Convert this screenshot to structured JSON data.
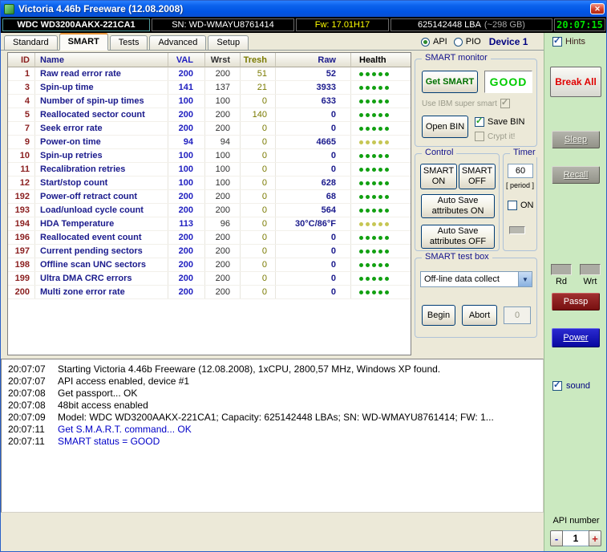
{
  "window": {
    "title": "Victoria 4.46b Freeware (12.08.2008)"
  },
  "info_bar": {
    "model": "WDC WD3200AAKX-221CA1",
    "serial": "SN: WD-WMAYU8761414",
    "firmware": "Fw: 17.01H17",
    "capacity": "625142448 LBA",
    "capacity_note": "(~298 GB)",
    "clock": "20:07:15"
  },
  "tabs": [
    "Standard",
    "SMART",
    "Tests",
    "Advanced",
    "Setup"
  ],
  "active_tab": "SMART",
  "mode_bar": {
    "api_label": "API",
    "pio_label": "PIO",
    "device_label": "Device 1",
    "hints_label": "Hints"
  },
  "smart_table": {
    "headers": [
      "ID",
      "Name",
      "VAL",
      "Wrst",
      "Tresh",
      "Raw",
      "Health"
    ],
    "health_dots": 5,
    "rows": [
      {
        "id": "1",
        "name": "Raw read error rate",
        "val": "200",
        "wrst": "200",
        "tresh": "51",
        "raw": "52",
        "health": "good"
      },
      {
        "id": "3",
        "name": "Spin-up time",
        "val": "141",
        "wrst": "137",
        "tresh": "21",
        "raw": "3933",
        "health": "good"
      },
      {
        "id": "4",
        "name": "Number of spin-up times",
        "val": "100",
        "wrst": "100",
        "tresh": "0",
        "raw": "633",
        "health": "good"
      },
      {
        "id": "5",
        "name": "Reallocated sector count",
        "val": "200",
        "wrst": "200",
        "tresh": "140",
        "raw": "0",
        "health": "good"
      },
      {
        "id": "7",
        "name": "Seek error rate",
        "val": "200",
        "wrst": "200",
        "tresh": "0",
        "raw": "0",
        "health": "good"
      },
      {
        "id": "9",
        "name": "Power-on time",
        "val": "94",
        "wrst": "94",
        "tresh": "0",
        "raw": "4665",
        "health": "warn"
      },
      {
        "id": "10",
        "name": "Spin-up retries",
        "val": "100",
        "wrst": "100",
        "tresh": "0",
        "raw": "0",
        "health": "good"
      },
      {
        "id": "11",
        "name": "Recalibration retries",
        "val": "100",
        "wrst": "100",
        "tresh": "0",
        "raw": "0",
        "health": "good"
      },
      {
        "id": "12",
        "name": "Start/stop count",
        "val": "100",
        "wrst": "100",
        "tresh": "0",
        "raw": "628",
        "health": "good"
      },
      {
        "id": "192",
        "name": "Power-off retract count",
        "val": "200",
        "wrst": "200",
        "tresh": "0",
        "raw": "68",
        "health": "good"
      },
      {
        "id": "193",
        "name": "Load/unload cycle count",
        "val": "200",
        "wrst": "200",
        "tresh": "0",
        "raw": "564",
        "health": "good"
      },
      {
        "id": "194",
        "name": "HDA Temperature",
        "val": "113",
        "wrst": "96",
        "tresh": "0",
        "raw": "30°C/86°F",
        "health": "warn"
      },
      {
        "id": "196",
        "name": "Reallocated event count",
        "val": "200",
        "wrst": "200",
        "tresh": "0",
        "raw": "0",
        "health": "good"
      },
      {
        "id": "197",
        "name": "Current pending sectors",
        "val": "200",
        "wrst": "200",
        "tresh": "0",
        "raw": "0",
        "health": "good"
      },
      {
        "id": "198",
        "name": "Offline scan UNC sectors",
        "val": "200",
        "wrst": "200",
        "tresh": "0",
        "raw": "0",
        "health": "good"
      },
      {
        "id": "199",
        "name": "Ultra DMA CRC errors",
        "val": "200",
        "wrst": "200",
        "tresh": "0",
        "raw": "0",
        "health": "good"
      },
      {
        "id": "200",
        "name": "Multi zone error rate",
        "val": "200",
        "wrst": "200",
        "tresh": "0",
        "raw": "0",
        "health": "good"
      }
    ]
  },
  "smart_monitor": {
    "title": "SMART monitor",
    "get_smart_button": "Get SMART",
    "status": "GOOD",
    "ibm_checkbox": "Use IBM super smart",
    "open_bin_button": "Open BIN",
    "save_bin_checkbox": "Save BIN",
    "crypt_checkbox": "Crypt it!"
  },
  "control": {
    "title": "Control",
    "smart_on_button": "SMART ON",
    "smart_off_button": "SMART OFF",
    "autosave_on_button": "Auto Save attributes ON",
    "autosave_off_button": "Auto Save attributes OFF"
  },
  "timer": {
    "title": "Timer",
    "value": "60",
    "period_label": "[ period ]",
    "on_label": "ON"
  },
  "test_box": {
    "title": "SMART test box",
    "selected_test": "Off-line data collect",
    "begin_button": "Begin",
    "abort_button": "Abort",
    "counter_value": "0"
  },
  "right_panel": {
    "break_all_button": "Break All",
    "sleep_button": "Sleep",
    "recall_button": "Recall",
    "rd_label": "Rd",
    "wrt_label": "Wrt",
    "passp_button": "Passp",
    "power_button": "Power",
    "sound_label": "sound",
    "api_number_label": "API number",
    "api_minus": "-",
    "api_value": "1",
    "api_plus": "+"
  },
  "log": {
    "lines": [
      {
        "time": "20:07:07",
        "text": "Starting Victoria 4.46b Freeware (12.08.2008), 1xCPU, 2800,57 MHz, Windows XP found.",
        "color": "black"
      },
      {
        "time": "20:07:07",
        "text": "API access enabled, device #1",
        "color": "black"
      },
      {
        "time": "20:07:08",
        "text": "Get passport... OK",
        "color": "black"
      },
      {
        "time": "20:07:08",
        "text": "48bit access enabled",
        "color": "black"
      },
      {
        "time": "20:07:09",
        "text": "Model: WDC WD3200AAKX-221CA1; Capacity: 625142448 LBAs; SN: WD-WMAYU8761414; FW: 1...",
        "color": "black"
      },
      {
        "time": "20:07:11",
        "text": "Get S.M.A.R.T. command... OK",
        "color": "blue"
      },
      {
        "time": "20:07:11",
        "text": "SMART status = GOOD",
        "color": "blue"
      }
    ]
  },
  "colors": {
    "titlebar_blue": "#0054E3",
    "panel_green": "#CBE9C0",
    "status_good": "#00CC00",
    "health_good": "#11A011",
    "health_warn": "#C6C654",
    "firmware_yellow": "#FFFF00",
    "clock_green": "#00E000",
    "break_red": "#E00000"
  }
}
